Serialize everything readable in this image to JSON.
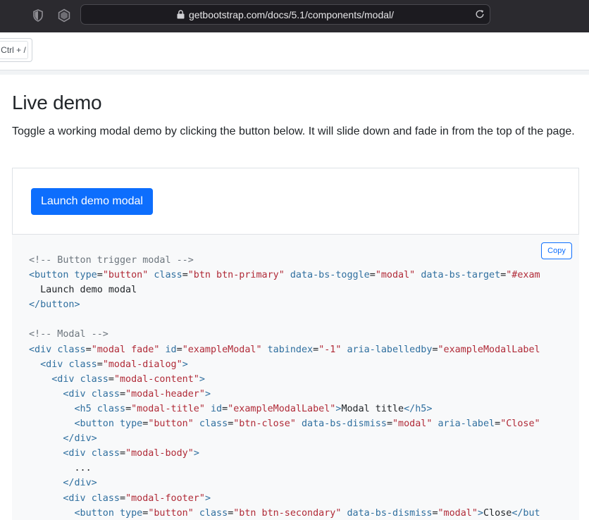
{
  "browser": {
    "url": "getbootstrap.com/docs/5.1/components/modal/"
  },
  "header": {
    "search_shortcut": "Ctrl + /"
  },
  "main": {
    "title": "Live demo",
    "description": "Toggle a working modal demo by clicking the button below. It will slide down and fade in from the top of the page.",
    "demo_button_label": "Launch demo modal",
    "copy_label": "Copy"
  },
  "code_lines": [
    [
      {
        "t": "com",
        "v": "<!-- Button trigger modal -->"
      }
    ],
    [
      {
        "t": "tag",
        "v": "<button "
      },
      {
        "t": "attr",
        "v": "type"
      },
      {
        "t": "txt",
        "v": "="
      },
      {
        "t": "str",
        "v": "\"button\""
      },
      {
        "t": "txt",
        "v": " "
      },
      {
        "t": "attr",
        "v": "class"
      },
      {
        "t": "txt",
        "v": "="
      },
      {
        "t": "str",
        "v": "\"btn btn-primary\""
      },
      {
        "t": "txt",
        "v": " "
      },
      {
        "t": "attr",
        "v": "data-bs-toggle"
      },
      {
        "t": "txt",
        "v": "="
      },
      {
        "t": "str",
        "v": "\"modal\""
      },
      {
        "t": "txt",
        "v": " "
      },
      {
        "t": "attr",
        "v": "data-bs-target"
      },
      {
        "t": "txt",
        "v": "="
      },
      {
        "t": "str",
        "v": "\"#exam"
      }
    ],
    [
      {
        "t": "txt",
        "v": "  Launch demo modal"
      }
    ],
    [
      {
        "t": "tag",
        "v": "</button>"
      }
    ],
    [
      {
        "t": "txt",
        "v": ""
      }
    ],
    [
      {
        "t": "com",
        "v": "<!-- Modal -->"
      }
    ],
    [
      {
        "t": "tag",
        "v": "<div "
      },
      {
        "t": "attr",
        "v": "class"
      },
      {
        "t": "txt",
        "v": "="
      },
      {
        "t": "str",
        "v": "\"modal fade\""
      },
      {
        "t": "txt",
        "v": " "
      },
      {
        "t": "attr",
        "v": "id"
      },
      {
        "t": "txt",
        "v": "="
      },
      {
        "t": "str",
        "v": "\"exampleModal\""
      },
      {
        "t": "txt",
        "v": " "
      },
      {
        "t": "attr",
        "v": "tabindex"
      },
      {
        "t": "txt",
        "v": "="
      },
      {
        "t": "str",
        "v": "\"-1\""
      },
      {
        "t": "txt",
        "v": " "
      },
      {
        "t": "attr",
        "v": "aria-labelledby"
      },
      {
        "t": "txt",
        "v": "="
      },
      {
        "t": "str",
        "v": "\"exampleModalLabel"
      }
    ],
    [
      {
        "t": "txt",
        "v": "  "
      },
      {
        "t": "tag",
        "v": "<div "
      },
      {
        "t": "attr",
        "v": "class"
      },
      {
        "t": "txt",
        "v": "="
      },
      {
        "t": "str",
        "v": "\"modal-dialog\""
      },
      {
        "t": "tag",
        "v": ">"
      }
    ],
    [
      {
        "t": "txt",
        "v": "    "
      },
      {
        "t": "tag",
        "v": "<div "
      },
      {
        "t": "attr",
        "v": "class"
      },
      {
        "t": "txt",
        "v": "="
      },
      {
        "t": "str",
        "v": "\"modal-content\""
      },
      {
        "t": "tag",
        "v": ">"
      }
    ],
    [
      {
        "t": "txt",
        "v": "      "
      },
      {
        "t": "tag",
        "v": "<div "
      },
      {
        "t": "attr",
        "v": "class"
      },
      {
        "t": "txt",
        "v": "="
      },
      {
        "t": "str",
        "v": "\"modal-header\""
      },
      {
        "t": "tag",
        "v": ">"
      }
    ],
    [
      {
        "t": "txt",
        "v": "        "
      },
      {
        "t": "tag",
        "v": "<h5 "
      },
      {
        "t": "attr",
        "v": "class"
      },
      {
        "t": "txt",
        "v": "="
      },
      {
        "t": "str",
        "v": "\"modal-title\""
      },
      {
        "t": "txt",
        "v": " "
      },
      {
        "t": "attr",
        "v": "id"
      },
      {
        "t": "txt",
        "v": "="
      },
      {
        "t": "str",
        "v": "\"exampleModalLabel\""
      },
      {
        "t": "tag",
        "v": ">"
      },
      {
        "t": "txt",
        "v": "Modal title"
      },
      {
        "t": "tag",
        "v": "</h5>"
      }
    ],
    [
      {
        "t": "txt",
        "v": "        "
      },
      {
        "t": "tag",
        "v": "<button "
      },
      {
        "t": "attr",
        "v": "type"
      },
      {
        "t": "txt",
        "v": "="
      },
      {
        "t": "str",
        "v": "\"button\""
      },
      {
        "t": "txt",
        "v": " "
      },
      {
        "t": "attr",
        "v": "class"
      },
      {
        "t": "txt",
        "v": "="
      },
      {
        "t": "str",
        "v": "\"btn-close\""
      },
      {
        "t": "txt",
        "v": " "
      },
      {
        "t": "attr",
        "v": "data-bs-dismiss"
      },
      {
        "t": "txt",
        "v": "="
      },
      {
        "t": "str",
        "v": "\"modal\""
      },
      {
        "t": "txt",
        "v": " "
      },
      {
        "t": "attr",
        "v": "aria-label"
      },
      {
        "t": "txt",
        "v": "="
      },
      {
        "t": "str",
        "v": "\"Close\""
      }
    ],
    [
      {
        "t": "txt",
        "v": "      "
      },
      {
        "t": "tag",
        "v": "</div>"
      }
    ],
    [
      {
        "t": "txt",
        "v": "      "
      },
      {
        "t": "tag",
        "v": "<div "
      },
      {
        "t": "attr",
        "v": "class"
      },
      {
        "t": "txt",
        "v": "="
      },
      {
        "t": "str",
        "v": "\"modal-body\""
      },
      {
        "t": "tag",
        "v": ">"
      }
    ],
    [
      {
        "t": "txt",
        "v": "        ..."
      }
    ],
    [
      {
        "t": "txt",
        "v": "      "
      },
      {
        "t": "tag",
        "v": "</div>"
      }
    ],
    [
      {
        "t": "txt",
        "v": "      "
      },
      {
        "t": "tag",
        "v": "<div "
      },
      {
        "t": "attr",
        "v": "class"
      },
      {
        "t": "txt",
        "v": "="
      },
      {
        "t": "str",
        "v": "\"modal-footer\""
      },
      {
        "t": "tag",
        "v": ">"
      }
    ],
    [
      {
        "t": "txt",
        "v": "        "
      },
      {
        "t": "tag",
        "v": "<button "
      },
      {
        "t": "attr",
        "v": "type"
      },
      {
        "t": "txt",
        "v": "="
      },
      {
        "t": "str",
        "v": "\"button\""
      },
      {
        "t": "txt",
        "v": " "
      },
      {
        "t": "attr",
        "v": "class"
      },
      {
        "t": "txt",
        "v": "="
      },
      {
        "t": "str",
        "v": "\"btn btn-secondary\""
      },
      {
        "t": "txt",
        "v": " "
      },
      {
        "t": "attr",
        "v": "data-bs-dismiss"
      },
      {
        "t": "txt",
        "v": "="
      },
      {
        "t": "str",
        "v": "\"modal\""
      },
      {
        "t": "tag",
        "v": ">"
      },
      {
        "t": "txt",
        "v": "Close"
      },
      {
        "t": "tag",
        "v": "</but"
      }
    ]
  ],
  "colors": {
    "primary": "#0d6efd",
    "chrome_bg": "#2b2a2f",
    "code_bg": "#f8f9fa",
    "code_string": "#b02a37",
    "code_tag": "#2f6f9f",
    "code_comment": "#6c757d"
  },
  "icons": [
    "shield-icon",
    "browser-extension-icon",
    "lock-icon",
    "reload-icon"
  ]
}
